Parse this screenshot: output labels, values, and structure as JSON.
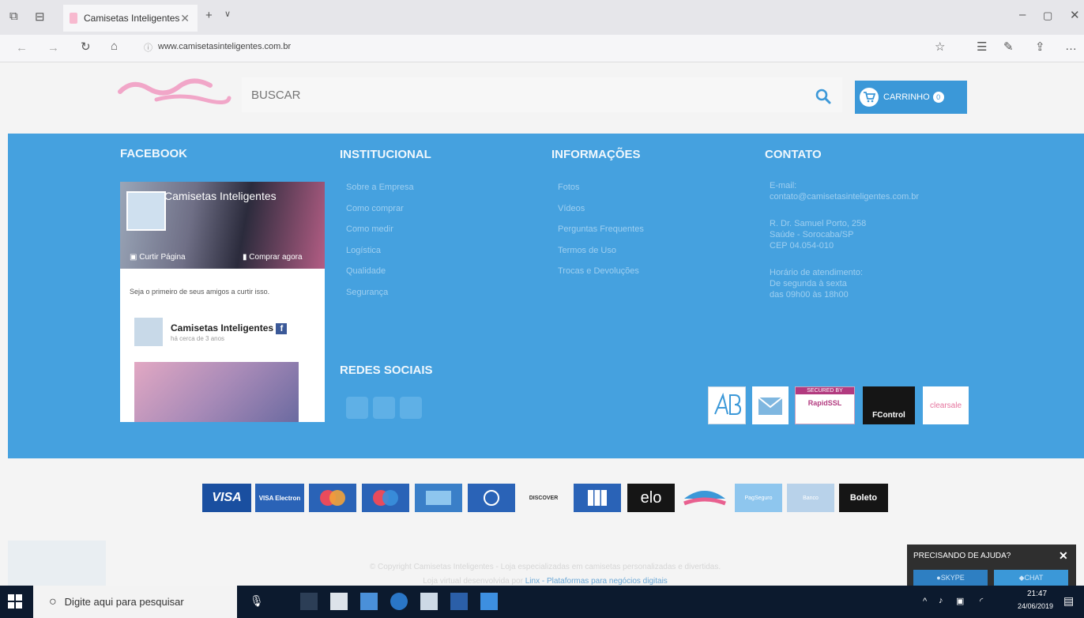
{
  "browser": {
    "tab_title": "Camisetas Inteligentes",
    "url": "www.camisetasinteligentes.com.br"
  },
  "header": {
    "search_placeholder": "BUSCAR",
    "cart_label": "CARRINHO",
    "cart_count": "0"
  },
  "footer": {
    "facebook": {
      "title": "FACEBOOK",
      "page_name": "Camisetas Inteligentes",
      "like_label": "Curtir Página",
      "shop_label": "Comprar agora",
      "friends_text": "Seja o primeiro de seus amigos a curtir isso.",
      "post_name": "Camisetas Inteligentes",
      "post_time": "há cerca de 3 anos"
    },
    "institucional": {
      "title": "INSTITUCIONAL",
      "items": [
        "Sobre a Empresa",
        "Como comprar",
        "Como medir",
        "Logística",
        "Qualidade",
        "Segurança"
      ]
    },
    "informacoes": {
      "title": "INFORMAÇÕES",
      "items": [
        "Fotos",
        "Vídeos",
        "Perguntas Frequentes",
        "Termos de Uso",
        "Trocas e Devoluções"
      ]
    },
    "contato": {
      "title": "CONTATO",
      "email_label": "E-mail:",
      "email": "contato@camisetasinteligentes.com.br",
      "address1": "R. Dr. Samuel Porto, 258",
      "address2": "Saúde - Sorocaba/SP",
      "cep": "CEP 04.054-010",
      "hours_label": "Horário de atendimento:",
      "hours1": "De segunda à sexta",
      "hours2": "das 09h00 às 18h00"
    },
    "redes_title": "REDES SOCIAIS",
    "seals": {
      "rapidssl_top": "SECURED BY",
      "rapidssl": "RapidSSL",
      "fcontrol": "FControl",
      "clearsale": "clearsale"
    }
  },
  "payments": [
    "VISA",
    "VISA Electron",
    "Mastercard",
    "Maestro",
    "American Express",
    "Diners Club",
    "DISCOVER",
    "JCB",
    "elo",
    "Aura",
    "PagSeguro",
    "Banco",
    "Boleto"
  ],
  "copyright": {
    "line1": "© Copyright Camisetas Inteligentes - Loja especializadas em camisetas personalizadas e divertidas.",
    "line2_prefix": "Loja virtual desenvolvida por",
    "line2_link": "Linx - Plataformas para negócios digitais"
  },
  "chat": {
    "title": "PRECISANDO DE AJUDA?",
    "skype": "SKYPE",
    "chat": "CHAT"
  },
  "taskbar": {
    "search_placeholder": "Digite aqui para pesquisar",
    "time": "21:47",
    "date": "24/06/2019"
  },
  "colors": {
    "footer_blue": "#45a1df",
    "accent_blue": "#3b98d8",
    "logo_pink": "#f1a6c8"
  }
}
